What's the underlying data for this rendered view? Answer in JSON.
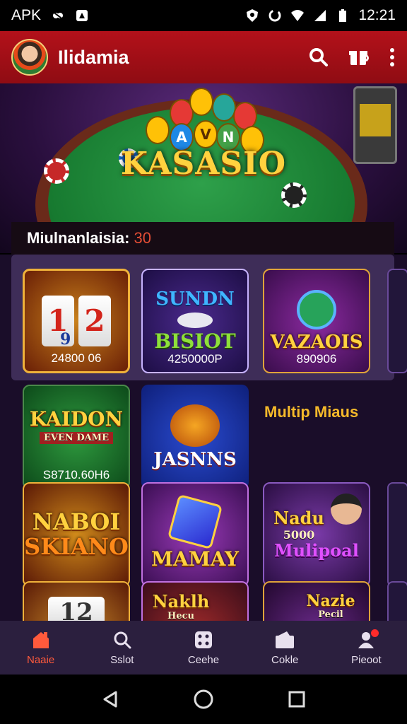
{
  "status_bar": {
    "left_text": "APK",
    "time": "12:21",
    "icons": [
      "bug-icon",
      "app-icon",
      "shield-icon",
      "data-saver-icon",
      "wifi-icon",
      "signal-icon",
      "battery-icon"
    ]
  },
  "app_bar": {
    "title": "Ilidamia",
    "actions": [
      "search-icon",
      "gift-icon",
      "more-icon"
    ],
    "colors": {
      "bar": "#b3111a"
    }
  },
  "hero": {
    "logo_text": "KASASIO",
    "coin_letters": [
      "A",
      "V",
      "N"
    ]
  },
  "ribbon": {
    "label": "Miulnanlaisia:",
    "count": "30"
  },
  "tiles": [
    {
      "reels": [
        "1",
        "2"
      ],
      "sub": "9",
      "price": "24800 06"
    },
    {
      "title_top": "SUNDN",
      "title_bottom": "BISIOT",
      "price": "4250000P"
    },
    {
      "title": "VAZAOIS",
      "price": "890906"
    },
    {
      "title": "KAIDON",
      "sub": "EVEN DAME",
      "price": "S8710.60H6"
    },
    {
      "title": "JASNNS"
    },
    {
      "title_top": "NABOI",
      "title_bottom": "SKIANO"
    },
    {
      "title": "MAMAY"
    },
    {
      "title_top": "Nadu",
      "mid": "5000",
      "title_bottom": "Mulipoal"
    },
    {
      "title": "12"
    },
    {
      "title_top": "Naklh",
      "title_bottom": "Hecu"
    },
    {
      "title_top": "Nazie",
      "title_bottom": "Pecil"
    }
  ],
  "multip_label": "Multip Miaus",
  "bottom_nav": [
    {
      "label": "Naaie",
      "icon": "home-icon",
      "active": true
    },
    {
      "label": "Sslot",
      "icon": "search-icon"
    },
    {
      "label": "Ceehe",
      "icon": "dice-icon"
    },
    {
      "label": "Cokle",
      "icon": "wallet-icon"
    },
    {
      "label": "Pieoot",
      "icon": "profile-icon",
      "badge": true
    }
  ]
}
